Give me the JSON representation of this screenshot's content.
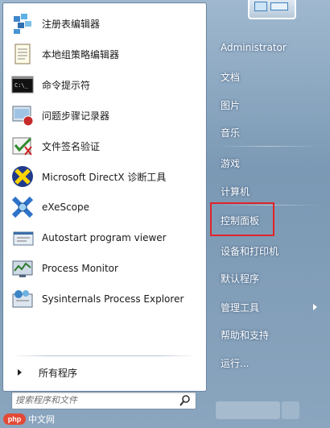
{
  "start_menu": {
    "programs": [
      {
        "label": "注册表编辑器",
        "icon": "registry-editor-icon"
      },
      {
        "label": "本地组策略编辑器",
        "icon": "group-policy-editor-icon"
      },
      {
        "label": "命令提示符",
        "icon": "command-prompt-icon"
      },
      {
        "label": "问题步骤记录器",
        "icon": "steps-recorder-icon"
      },
      {
        "label": "文件签名验证",
        "icon": "file-signature-verification-icon"
      },
      {
        "label": "Microsoft DirectX 诊断工具",
        "icon": "directx-diagnostic-icon"
      },
      {
        "label": "eXeScope",
        "icon": "exescope-icon"
      },
      {
        "label": "Autostart program viewer",
        "icon": "autostart-viewer-icon"
      },
      {
        "label": "Process Monitor",
        "icon": "process-monitor-icon"
      },
      {
        "label": "Sysinternals Process Explorer",
        "icon": "process-explorer-icon"
      }
    ],
    "all_programs_label": "所有程序",
    "search_placeholder": "搜索程序和文件",
    "right_items": [
      {
        "label": "Administrator",
        "has_submenu": false
      },
      {
        "label": "文档",
        "has_submenu": false
      },
      {
        "label": "图片",
        "has_submenu": false
      },
      {
        "label": "音乐",
        "has_submenu": false
      },
      {
        "label": "游戏",
        "has_submenu": false
      },
      {
        "label": "计算机",
        "has_submenu": false
      },
      {
        "label": "控制面板",
        "has_submenu": false
      },
      {
        "label": "设备和打印机",
        "has_submenu": false
      },
      {
        "label": "默认程序",
        "has_submenu": false
      },
      {
        "label": "管理工具",
        "has_submenu": true
      },
      {
        "label": "帮助和支持",
        "has_submenu": false
      },
      {
        "label": "运行...",
        "has_submenu": false
      }
    ],
    "highlighted_item": "控制面板"
  },
  "watermark": {
    "logo": "php",
    "text": "中文网"
  },
  "colors": {
    "highlight": "#e0242a",
    "pane_right": "#7f9db7"
  }
}
